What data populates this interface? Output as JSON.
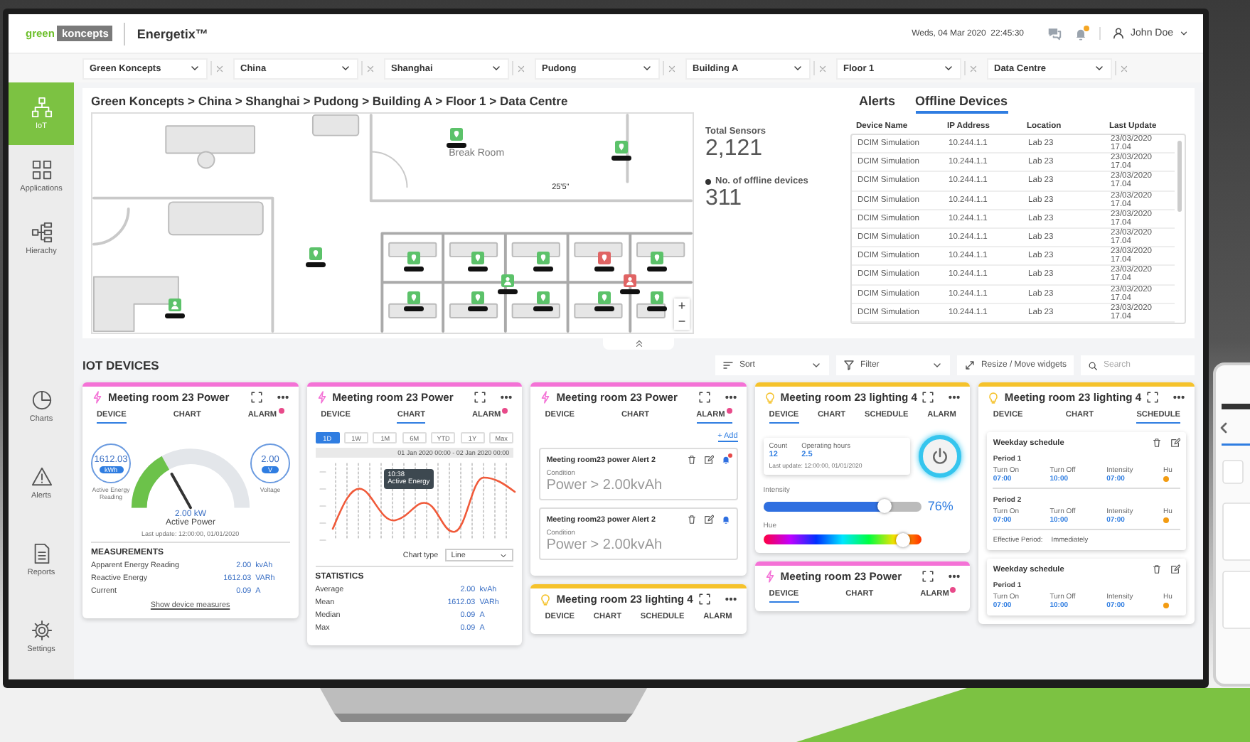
{
  "header": {
    "logo": {
      "word_1": "green",
      "word_2": "koncepts"
    },
    "app_name": "Energetix™",
    "datetime": "Weds, 04 Mar 2020  22:45:30",
    "notifications_unread": true,
    "user": "John Doe"
  },
  "filters": [
    {
      "value": "Green Koncepts"
    },
    {
      "value": "China"
    },
    {
      "value": "Shanghai"
    },
    {
      "value": "Pudong"
    },
    {
      "value": "Building A"
    },
    {
      "value": "Floor 1"
    },
    {
      "value": "Data Centre"
    }
  ],
  "sidebar": {
    "top_items": [
      {
        "label": "IoT",
        "selected": true
      },
      {
        "label": "Applications",
        "selected": false
      },
      {
        "label": "Hierachy",
        "selected": false
      }
    ],
    "bottom_items": [
      {
        "label": "Charts",
        "selected": false
      },
      {
        "label": "Alerts",
        "selected": false
      },
      {
        "label": "Reports",
        "selected": false
      },
      {
        "label": "Settings",
        "selected": false
      }
    ]
  },
  "breadcrumb": "Green Koncepts > China > Shanghai > Pudong > Building A > Floor 1 > Data Centre",
  "floor_plan": {
    "room_label": "Break Room",
    "dimension": "25'5\"",
    "zoom_in": "+",
    "zoom_out": "−",
    "sensors": [
      {
        "kind": "meter",
        "color": "#5cc26a"
      },
      {
        "kind": "meter",
        "color": "#5cc26a"
      },
      {
        "kind": "meter",
        "color": "#5cc26a"
      },
      {
        "kind": "person",
        "color": "#5cc26a"
      },
      {
        "kind": "meter",
        "color": "#5cc26a"
      },
      {
        "kind": "meter",
        "color": "#5cc26a"
      },
      {
        "kind": "meter",
        "color": "#5cc26a"
      },
      {
        "kind": "meter",
        "color": "#e06464"
      },
      {
        "kind": "meter",
        "color": "#5cc26a"
      },
      {
        "kind": "person",
        "color": "#5cc26a"
      },
      {
        "kind": "person",
        "color": "#e06464"
      },
      {
        "kind": "meter",
        "color": "#5cc26a"
      },
      {
        "kind": "meter",
        "color": "#5cc26a"
      },
      {
        "kind": "meter",
        "color": "#5cc26a"
      },
      {
        "kind": "meter",
        "color": "#5cc26a"
      },
      {
        "kind": "meter",
        "color": "#5cc26a"
      }
    ]
  },
  "stats": [
    {
      "label": "Total Sensors",
      "value": "2,121",
      "bullet": false
    },
    {
      "label": "No. of offline devices",
      "value": "311",
      "bullet": true
    }
  ],
  "devices_panel": {
    "tabs": [
      {
        "label": "Alerts",
        "selected": false
      },
      {
        "label": "Offline Devices",
        "selected": true
      }
    ],
    "columns": [
      "Device Name",
      "IP Address",
      "Location",
      "Last Update"
    ],
    "rows": [
      [
        "DCIM Simulation",
        "10.244.1.1",
        "Lab 23",
        "23/03/2020 17.04"
      ],
      [
        "DCIM Simulation",
        "10.244.1.1",
        "Lab 23",
        "23/03/2020 17.04"
      ],
      [
        "DCIM Simulation",
        "10.244.1.1",
        "Lab 23",
        "23/03/2020 17.04"
      ],
      [
        "DCIM Simulation",
        "10.244.1.1",
        "Lab 23",
        "23/03/2020 17.04"
      ],
      [
        "DCIM Simulation",
        "10.244.1.1",
        "Lab 23",
        "23/03/2020 17.04"
      ],
      [
        "DCIM Simulation",
        "10.244.1.1",
        "Lab 23",
        "23/03/2020 17.04"
      ],
      [
        "DCIM Simulation",
        "10.244.1.1",
        "Lab 23",
        "23/03/2020 17.04"
      ],
      [
        "DCIM Simulation",
        "10.244.1.1",
        "Lab 23",
        "23/03/2020 17.04"
      ],
      [
        "DCIM Simulation",
        "10.244.1.1",
        "Lab 23",
        "23/03/2020 17.04"
      ],
      [
        "DCIM Simulation",
        "10.244.1.1",
        "Lab 23",
        "23/03/2020 17.04"
      ]
    ]
  },
  "iot": {
    "title": "IOT DEVICES",
    "sort": "Sort",
    "filter": "Filter",
    "resize": "Resize / Move widgets",
    "search_placeholder": "Search"
  },
  "widget_columns": [
    [
      {
        "kind": "power-device",
        "color": "#f472d6",
        "title": "Meeting room 23 Power",
        "tabs": [
          {
            "label": "DEVICE",
            "selected": true,
            "alert": false
          },
          {
            "label": "CHART",
            "selected": false,
            "alert": false
          },
          {
            "label": "ALARM",
            "selected": false,
            "alert": true
          }
        ],
        "readings": [
          {
            "value": "1612.03",
            "unit": "kWh",
            "label": "Active Energy Reading"
          },
          {
            "value": "2.00",
            "unit": "V",
            "label": "Voltage"
          }
        ],
        "gauge": {
          "level": 0.32,
          "value": "2.00 kW",
          "label": "Active Power"
        },
        "last_update": "Last update: 12:00:00, 01/01/2020",
        "measurements": {
          "title": "MEASUREMENTS",
          "rows": [
            {
              "label": "Apparent Energy Reading",
              "value": "2.00",
              "unit": "kvAh"
            },
            {
              "label": "Reactive Energy",
              "value": "1612.03",
              "unit": "VARh"
            },
            {
              "label": "Current",
              "value": "0.09",
              "unit": "A"
            }
          ]
        },
        "link": "Show device measures"
      }
    ],
    [
      {
        "kind": "power-chart",
        "color": "#f472d6",
        "title": "Meeting room 23 Power",
        "tabs": [
          {
            "label": "DEVICE",
            "selected": false,
            "alert": false
          },
          {
            "label": "CHART",
            "selected": true,
            "alert": false
          },
          {
            "label": "ALARM",
            "selected": false,
            "alert": true
          }
        ],
        "ranges": [
          {
            "label": "1D",
            "selected": true
          },
          {
            "label": "1W",
            "selected": false
          },
          {
            "label": "1M",
            "selected": false
          },
          {
            "label": "6M",
            "selected": false
          },
          {
            "label": "YTD",
            "selected": false
          },
          {
            "label": "1Y",
            "selected": false
          },
          {
            "label": "Max",
            "selected": false
          }
        ],
        "date_range": "01 Jan 2020 00:00 - 02 Jan 2020 00:00",
        "tooltip": {
          "time": "10:38",
          "label": "Active Energy"
        },
        "chart_type": {
          "label": "Chart type",
          "value": "Line"
        },
        "statistics": {
          "title": "STATISTICS",
          "rows": [
            {
              "label": "Average",
              "value": "2.00",
              "unit": "kvAh"
            },
            {
              "label": "Mean",
              "value": "1612.03",
              "unit": "VARh"
            },
            {
              "label": "Median",
              "value": "0.09",
              "unit": "A"
            },
            {
              "label": "Max",
              "value": "0.09",
              "unit": "A"
            }
          ]
        }
      }
    ],
    [
      {
        "kind": "power-alarm",
        "color": "#f472d6",
        "title": "Meeting room 23 Power",
        "tabs": [
          {
            "label": "DEVICE",
            "selected": false,
            "alert": false
          },
          {
            "label": "CHART",
            "selected": false,
            "alert": false
          },
          {
            "label": "ALARM",
            "selected": true,
            "alert": true
          }
        ],
        "add": "+ Add",
        "alerts": [
          {
            "title": "Meeting room23 power Alert 2",
            "condition_label": "Condition",
            "condition": "Power > 2.00kvAh",
            "unread": true
          },
          {
            "title": "Meeting room23 power Alert 2",
            "condition_label": "Condition",
            "condition": "Power > 2.00kvAh",
            "unread": false
          }
        ]
      },
      {
        "kind": "lighting-header",
        "color": "#f5c22b",
        "title": "Meeting room 23 lighting 4",
        "tabs": [
          {
            "label": "DEVICE",
            "selected": false,
            "alert": false
          },
          {
            "label": "CHART",
            "selected": false,
            "alert": false
          },
          {
            "label": "SCHEDULE",
            "selected": false,
            "alert": false
          },
          {
            "label": "ALARM",
            "selected": false,
            "alert": false
          }
        ]
      }
    ],
    [
      {
        "kind": "lighting-device",
        "color": "#f5c22b",
        "title": "Meeting room 23 lighting 4",
        "tabs": [
          {
            "label": "DEVICE",
            "selected": true,
            "alert": false
          },
          {
            "label": "CHART",
            "selected": false,
            "alert": false
          },
          {
            "label": "SCHEDULE",
            "selected": false,
            "alert": false
          },
          {
            "label": "ALARM",
            "selected": false,
            "alert": false
          }
        ],
        "counters": [
          {
            "label": "Count",
            "value": "12"
          },
          {
            "label": "Operating hours",
            "value": "2.5"
          }
        ],
        "last_update": "Last update: 12:00:00, 01/01/2020",
        "power_on": true,
        "intensity": {
          "label": "Intensity",
          "level": 0.76,
          "reading": "76%"
        },
        "hue": {
          "label": "Hue",
          "level": 0.88
        }
      },
      {
        "kind": "power-header",
        "color": "#f472d6",
        "title": "Meeting room 23 Power",
        "tabs": [
          {
            "label": "DEVICE",
            "selected": true,
            "alert": false
          },
          {
            "label": "CHART",
            "selected": false,
            "alert": false
          },
          {
            "label": "ALARM",
            "selected": false,
            "alert": true
          }
        ]
      }
    ],
    [
      {
        "kind": "lighting-schedule",
        "color": "#f5c22b",
        "title": "Meeting room 23 lighting 4",
        "tabs": [
          {
            "label": "DEVICE",
            "selected": false,
            "alert": false
          },
          {
            "label": "CHART",
            "selected": false,
            "alert": false
          },
          {
            "label": "SCHEDULE",
            "selected": true,
            "alert": false
          }
        ],
        "schedules": [
          {
            "title": "Weekday schedule",
            "periods": [
              {
                "title": "Period 1",
                "fields": [
                  {
                    "label": "Turn On",
                    "value": "07:00"
                  },
                  {
                    "label": "Turn Off",
                    "value": "10:00"
                  },
                  {
                    "label": "Intensity",
                    "value": "07:00"
                  },
                  {
                    "label": "Hu"
                  }
                ]
              },
              {
                "title": "Period 2",
                "fields": [
                  {
                    "label": "Turn On",
                    "value": "07:00"
                  },
                  {
                    "label": "Turn Off",
                    "value": "10:00"
                  },
                  {
                    "label": "Intensity",
                    "value": "07:00"
                  },
                  {
                    "label": "Hu"
                  }
                ]
              }
            ],
            "effective": {
              "label": "Effective Period:",
              "value": "Immediately"
            }
          },
          {
            "title": "Weekday schedule",
            "periods": [
              {
                "title": "Period 1",
                "fields": [
                  {
                    "label": "Turn On",
                    "value": "07:00"
                  },
                  {
                    "label": "Turn Off",
                    "value": "10:00"
                  },
                  {
                    "label": "Intensity",
                    "value": "07:00"
                  },
                  {
                    "label": "Hu"
                  }
                ]
              }
            ]
          }
        ]
      }
    ]
  ]
}
